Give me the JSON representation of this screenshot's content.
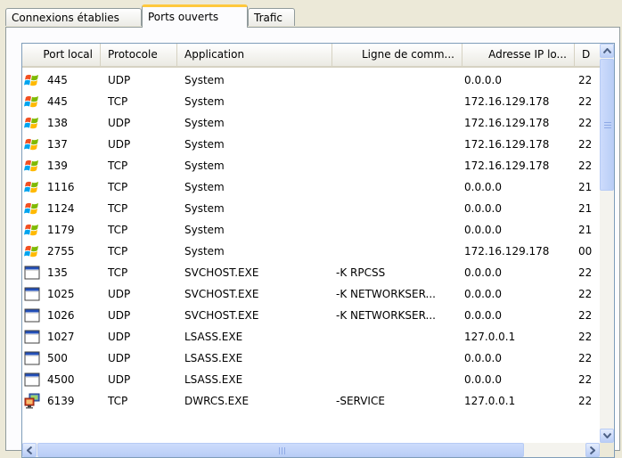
{
  "tabs": [
    {
      "label": "Connexions établies",
      "active": false
    },
    {
      "label": "Ports ouverts",
      "active": true
    },
    {
      "label": "Trafic",
      "active": false
    }
  ],
  "columns": [
    "Port local",
    "Protocole",
    "Application",
    "Ligne de comm...",
    "Adresse IP lo...",
    "D"
  ],
  "rows": [
    {
      "icon": "windows-logo-icon",
      "port": "445",
      "proto": "UDP",
      "app": "System",
      "cmd": "",
      "ip": "0.0.0.0",
      "d": "22"
    },
    {
      "icon": "windows-logo-icon",
      "port": "445",
      "proto": "TCP",
      "app": "System",
      "cmd": "",
      "ip": "172.16.129.178",
      "d": "22"
    },
    {
      "icon": "windows-logo-icon",
      "port": "138",
      "proto": "UDP",
      "app": "System",
      "cmd": "",
      "ip": "172.16.129.178",
      "d": "22"
    },
    {
      "icon": "windows-logo-icon",
      "port": "137",
      "proto": "UDP",
      "app": "System",
      "cmd": "",
      "ip": "172.16.129.178",
      "d": "22"
    },
    {
      "icon": "windows-logo-icon",
      "port": "139",
      "proto": "TCP",
      "app": "System",
      "cmd": "",
      "ip": "172.16.129.178",
      "d": "22"
    },
    {
      "icon": "windows-logo-icon",
      "port": "1116",
      "proto": "TCP",
      "app": "System",
      "cmd": "",
      "ip": "0.0.0.0",
      "d": "21"
    },
    {
      "icon": "windows-logo-icon",
      "port": "1124",
      "proto": "TCP",
      "app": "System",
      "cmd": "",
      "ip": "0.0.0.0",
      "d": "21"
    },
    {
      "icon": "windows-logo-icon",
      "port": "1179",
      "proto": "TCP",
      "app": "System",
      "cmd": "",
      "ip": "0.0.0.0",
      "d": "21"
    },
    {
      "icon": "windows-logo-icon",
      "port": "2755",
      "proto": "TCP",
      "app": "System",
      "cmd": "",
      "ip": "172.16.129.178",
      "d": "00"
    },
    {
      "icon": "window-app-icon",
      "port": "135",
      "proto": "TCP",
      "app": "SVCHOST.EXE",
      "cmd": "-K RPCSS",
      "ip": "0.0.0.0",
      "d": "22"
    },
    {
      "icon": "window-app-icon",
      "port": "1025",
      "proto": "UDP",
      "app": "SVCHOST.EXE",
      "cmd": "-K NETWORKSER...",
      "ip": "0.0.0.0",
      "d": "22"
    },
    {
      "icon": "window-app-icon",
      "port": "1026",
      "proto": "UDP",
      "app": "SVCHOST.EXE",
      "cmd": "-K NETWORKSER...",
      "ip": "0.0.0.0",
      "d": "22"
    },
    {
      "icon": "window-app-icon",
      "port": "1027",
      "proto": "UDP",
      "app": "LSASS.EXE",
      "cmd": "",
      "ip": "127.0.0.1",
      "d": "22"
    },
    {
      "icon": "window-app-icon",
      "port": "500",
      "proto": "UDP",
      "app": "LSASS.EXE",
      "cmd": "",
      "ip": "0.0.0.0",
      "d": "22"
    },
    {
      "icon": "window-app-icon",
      "port": "4500",
      "proto": "UDP",
      "app": "LSASS.EXE",
      "cmd": "",
      "ip": "0.0.0.0",
      "d": "22"
    },
    {
      "icon": "remote-computers-icon",
      "port": "6139",
      "proto": "TCP",
      "app": "DWRCS.EXE",
      "cmd": "-SERVICE",
      "ip": "127.0.0.1",
      "d": "22"
    }
  ]
}
